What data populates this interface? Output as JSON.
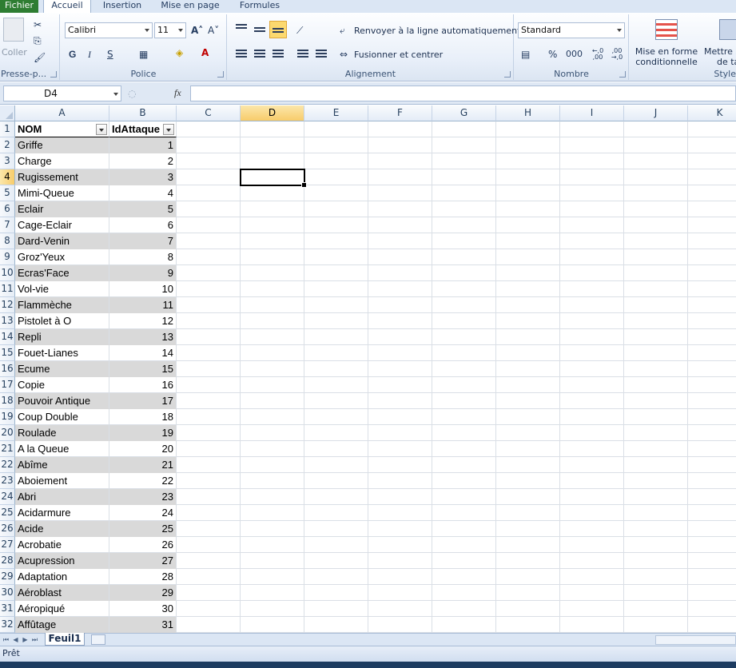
{
  "tabs": [
    "Fichier",
    "Accueil",
    "Insertion",
    "Mise en page",
    "Formules"
  ],
  "ribbon": {
    "clipboard": {
      "label": "Presse-p...",
      "paste": "Coller"
    },
    "font": {
      "label": "Police",
      "name": "Calibri",
      "size": "11",
      "bold": "G",
      "italic": "I",
      "underline": "S"
    },
    "alignment": {
      "label": "Alignement",
      "wrap": "Renvoyer à la ligne automatiquement",
      "merge": "Fusionner et centrer"
    },
    "number": {
      "label": "Nombre",
      "format": "Standard",
      "percent": "%",
      "thousands": "000",
      "inc": "←,0 ,00",
      "dec": ",00 →,0"
    },
    "styles": {
      "label": "Style",
      "conditional_1": "Mise en forme",
      "conditional_2": "conditionnelle",
      "table_1": "Mettre s",
      "table_2": "de ta"
    }
  },
  "formula_bar": {
    "name_box": "D4",
    "fx": "fx",
    "value": ""
  },
  "grid": {
    "columns": [
      "A",
      "B",
      "C",
      "D",
      "E",
      "F",
      "G",
      "H",
      "I",
      "J",
      "K"
    ],
    "selected_column": "D",
    "selected_row": 4,
    "header": [
      "NOM",
      "IdAttaque"
    ],
    "rows": [
      [
        "Griffe",
        1
      ],
      [
        "Charge",
        2
      ],
      [
        "Rugissement",
        3
      ],
      [
        "Mimi-Queue",
        4
      ],
      [
        "Eclair",
        5
      ],
      [
        "Cage-Eclair",
        6
      ],
      [
        "Dard-Venin",
        7
      ],
      [
        "Groz'Yeux",
        8
      ],
      [
        "Ecras'Face",
        9
      ],
      [
        "Vol-vie",
        10
      ],
      [
        "Flammèche",
        11
      ],
      [
        "Pistolet à O",
        12
      ],
      [
        "Repli",
        13
      ],
      [
        "Fouet-Lianes",
        14
      ],
      [
        "Ecume",
        15
      ],
      [
        "Copie",
        16
      ],
      [
        "Pouvoir Antique",
        17
      ],
      [
        "Coup Double",
        18
      ],
      [
        "Roulade",
        19
      ],
      [
        "A la Queue",
        20
      ],
      [
        "Abîme",
        21
      ],
      [
        "Aboiement",
        22
      ],
      [
        "Abri",
        23
      ],
      [
        "Acidarmure",
        24
      ],
      [
        "Acide",
        25
      ],
      [
        "Acrobatie",
        26
      ],
      [
        "Acupression",
        27
      ],
      [
        "Adaptation",
        28
      ],
      [
        "Aéroblast",
        29
      ],
      [
        "Aéropiqué",
        30
      ],
      [
        "Affûtage",
        31
      ]
    ]
  },
  "sheet_tabs": [
    "Feuil1"
  ],
  "status": "Prêt",
  "colors": {
    "file_tab": "#2e7d32",
    "band": "#d9d9d9",
    "selection_header": "#f8cc6a"
  }
}
